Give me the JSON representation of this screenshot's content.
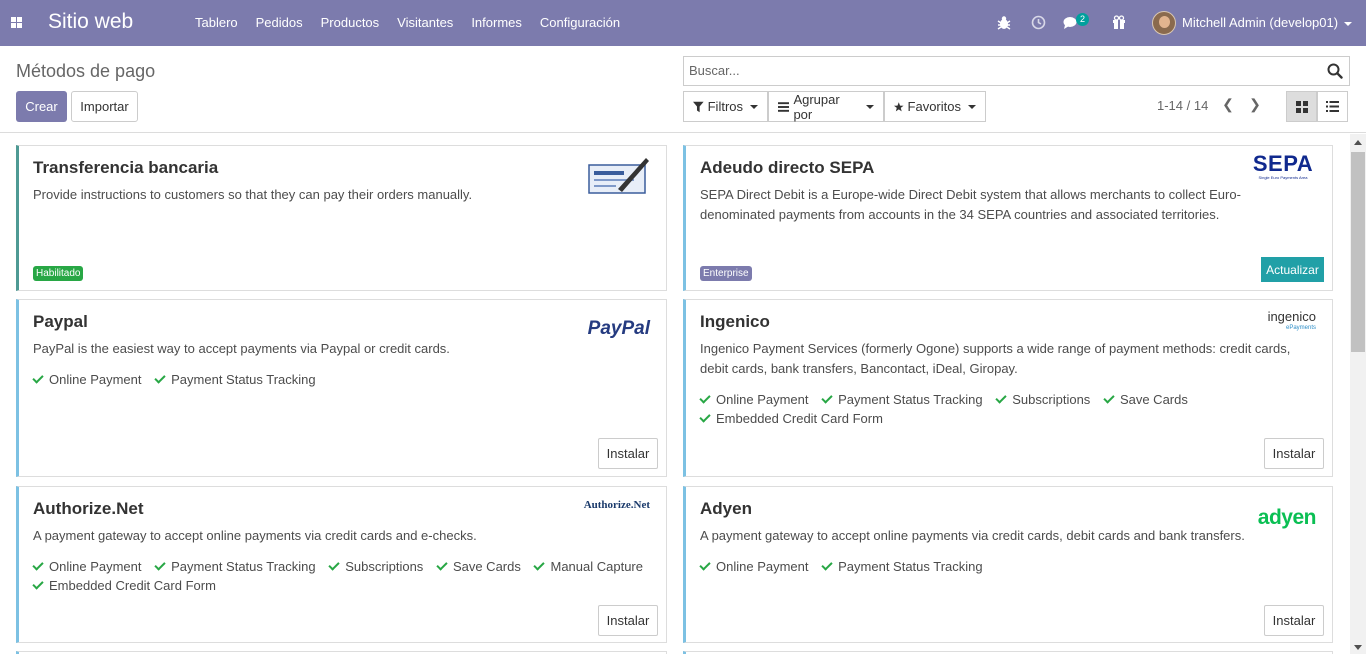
{
  "topbar": {
    "brand": "Sitio web",
    "menu": [
      "Tablero",
      "Pedidos",
      "Productos",
      "Visitantes",
      "Informes",
      "Configuración"
    ],
    "messages_count": "2",
    "user_name": "Mitchell Admin (develop01)",
    "icons": [
      "apps-icon",
      "bug-icon",
      "clock-icon",
      "chat-icon",
      "gift-icon",
      "avatar",
      "caret-down-icon"
    ]
  },
  "control_panel": {
    "title": "Métodos de pago",
    "create_label": "Crear",
    "import_label": "Importar",
    "search_placeholder": "Buscar...",
    "filters_label": "Filtros",
    "group_by_label": "Agrupar por",
    "favorites_label": "Favoritos",
    "pager": "1-14 / 14"
  },
  "cards": [
    {
      "title": "Transferencia bancaria",
      "description": "Provide instructions to customers so that they can pay their orders manually.",
      "features": [],
      "tag": "Habilitado",
      "logo": "check-cheque-logo"
    },
    {
      "title": "Adeudo directo SEPA",
      "description": "SEPA Direct Debit is a Europe-wide Direct Debit system that allows merchants to collect Euro-denominated payments from accounts in the 34 SEPA countries and associated territories.",
      "features": [],
      "tag": "Enterprise",
      "action": "Actualizar",
      "logo_text": "SEPA",
      "logo_sub": "Single Euro Payments Area"
    },
    {
      "title": "Paypal",
      "description": "PayPal is the easiest way to accept payments via Paypal or credit cards.",
      "features": [
        "Online Payment",
        "Payment Status Tracking"
      ],
      "action": "Instalar",
      "logo_text": "PayPal"
    },
    {
      "title": "Ingenico",
      "description": "Ingenico Payment Services (formerly Ogone) supports a wide range of payment methods: credit cards, debit cards, bank transfers, Bancontact, iDeal, Giropay.",
      "features": [
        "Online Payment",
        "Payment Status Tracking",
        "Subscriptions",
        "Save Cards",
        "Embedded Credit Card Form"
      ],
      "action": "Instalar",
      "logo_text": "ingenico",
      "logo_sub": "ePayments"
    },
    {
      "title": "Authorize.Net",
      "description": "A payment gateway to accept online payments via credit cards and e-checks.",
      "features": [
        "Online Payment",
        "Payment Status Tracking",
        "Subscriptions",
        "Save Cards",
        "Manual Capture",
        "Embedded Credit Card Form"
      ],
      "action": "Instalar",
      "logo_text": "Authorize.Net"
    },
    {
      "title": "Adyen",
      "description": "A payment gateway to accept online payments via credit cards, debit cards and bank transfers.",
      "features": [
        "Online Payment",
        "Payment Status Tracking"
      ],
      "action": "Instalar",
      "logo_text": "adyen"
    }
  ],
  "colors": {
    "topbar": "#7c7bad",
    "primary": "#7c7bad",
    "enabled_tag": "#28a745",
    "enterprise_tag": "#7c7bad",
    "upgrade_button": "#21a0a7",
    "check": "#28a745",
    "card_border": "#7cc1e3"
  }
}
